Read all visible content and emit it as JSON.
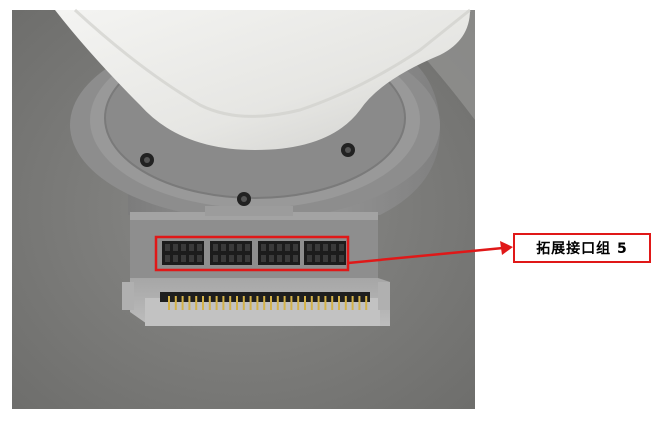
{
  "callout": {
    "label": "拓展接口组 5",
    "color": "#e01818"
  },
  "scene": {
    "subject": "robot-arm-joint-base",
    "background_color": "#7d7d7b",
    "body_color": "#8f8f8f"
  }
}
